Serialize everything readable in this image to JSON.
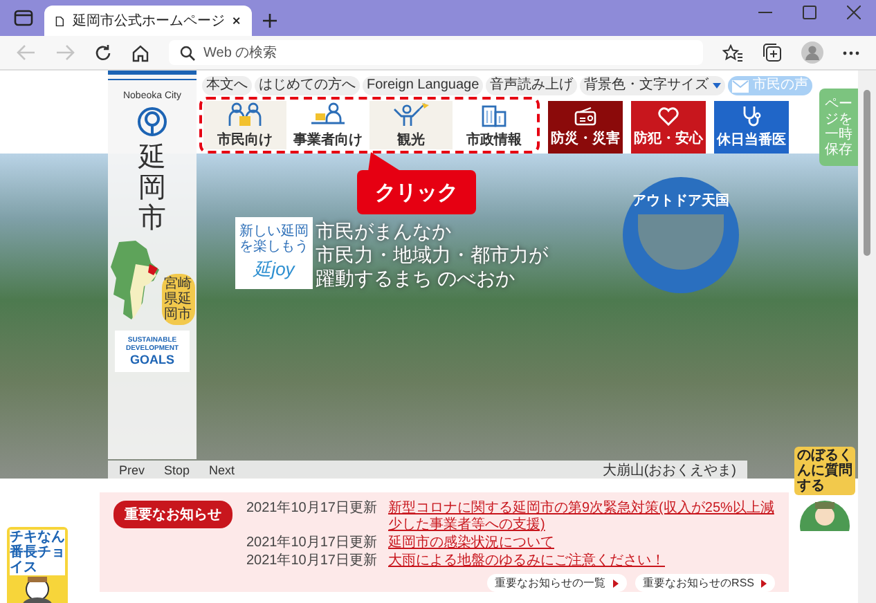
{
  "browser": {
    "tab_title": "延岡市公式ホームページ",
    "address_placeholder": "Web の検索",
    "back_disabled": true,
    "forward_disabled": true
  },
  "top_links": [
    {
      "label": "本文へ",
      "kind": "link"
    },
    {
      "label": "はじめての方へ",
      "kind": "link"
    },
    {
      "label": "Foreign Language",
      "kind": "link"
    },
    {
      "label": "音声読み上げ",
      "kind": "link"
    },
    {
      "label": "背景色・文字サイズ",
      "kind": "dropdown"
    },
    {
      "label": "市民の声",
      "kind": "mail"
    }
  ],
  "logo": {
    "city_en": "Nobeoka City",
    "city_name": "延岡市",
    "map_label": "宮崎県延岡市",
    "sdgs": [
      "SUSTAINABLE",
      "DEVELOPMENT",
      "GOALS"
    ]
  },
  "nav": [
    {
      "label": "市民向け",
      "kind": "audience"
    },
    {
      "label": "事業者向け",
      "kind": "audience"
    },
    {
      "label": "観光",
      "kind": "audience"
    },
    {
      "label": "市政情報",
      "kind": "audience"
    },
    {
      "label": "防災・災害",
      "kind": "emergency",
      "color": "#8b0a0a"
    },
    {
      "label": "防犯・安心",
      "kind": "emergency",
      "color": "#c8161d"
    },
    {
      "label": "休日当番医",
      "kind": "emergency",
      "color": "#2066c8"
    }
  ],
  "callout": "クリック",
  "hero": {
    "logo_tagline": "新しい延岡を楽しもう",
    "logo_text": "延joy",
    "slogan": [
      "市民がまんなか",
      "市民力・地域力・都市力が",
      "躍動するまち のべおか"
    ],
    "badge": "アウトドア天国"
  },
  "slideshow": {
    "controls": [
      "Prev",
      "Stop",
      "Next"
    ],
    "caption": "大崩山(おおくえやま)"
  },
  "side_save": "ページを一時保存",
  "mascot_right": "のぼるくんに質問する",
  "mascot_left": "チキなん番長チョイス",
  "notices": {
    "heading": "重要なお知らせ",
    "items": [
      {
        "date": "2021年10月17日更新",
        "title": "新型コロナに関する延岡市の第9次緊急対策(収入が25%以上減少した事業者等への支援)"
      },
      {
        "date": "2021年10月17日更新",
        "title": "延岡市の感染状況について"
      },
      {
        "date": "2021年10月17日更新",
        "title": "大雨による地盤のゆるみにご注意ください！"
      }
    ],
    "links": [
      "重要なお知らせの一覧",
      "重要なお知らせのRSS"
    ]
  }
}
